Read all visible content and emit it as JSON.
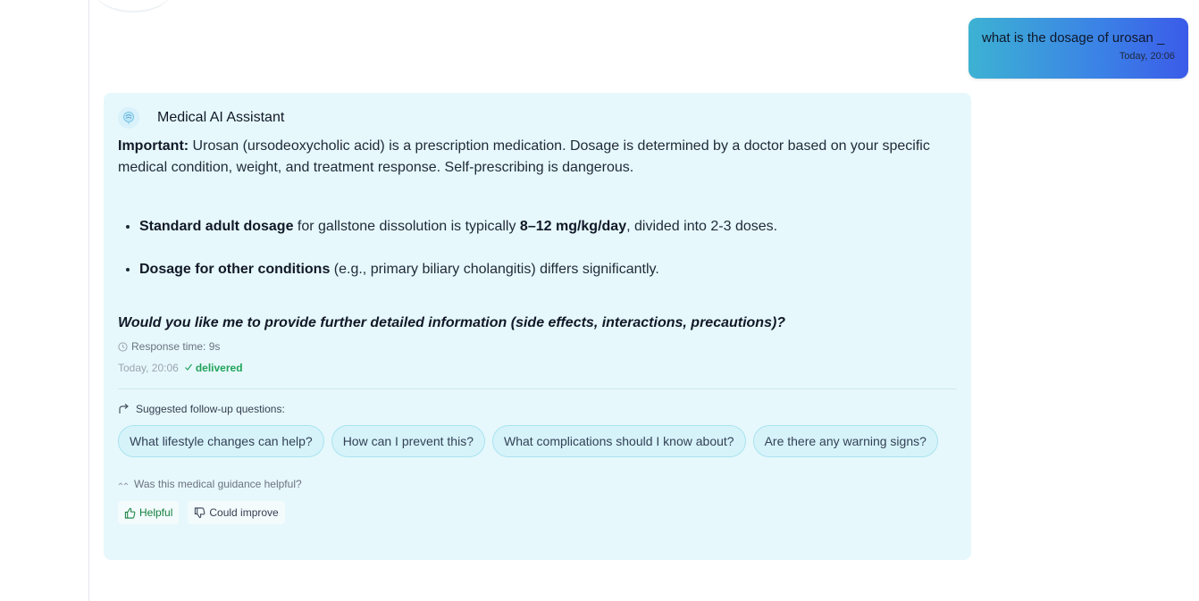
{
  "user_message": {
    "text": "what is the dosage of urosan _",
    "timestamp": "Today, 20:06"
  },
  "assistant": {
    "name": "Medical AI Assistant",
    "avatar_icon": "brain-icon",
    "intro_bold": "Important:",
    "intro_text": " Urosan (ursodeoxycholic acid) is a prescription medication. Dosage is determined by a doctor based on your specific medical condition, weight, and treatment response. Self-prescribing is dangerous.",
    "points": [
      {
        "bold": "Standard adult dosage",
        "text1": " for gallstone dissolution is typically ",
        "bold2": "8–12 mg/kg/day",
        "text2": ", divided into 2-3 doses."
      },
      {
        "bold": "Dosage for other conditions",
        "text1": " (e.g., primary biliary cholangitis) differs significantly.",
        "bold2": "",
        "text2": ""
      }
    ],
    "question": "Would you like me to provide further detailed information (side effects, interactions, precautions)?",
    "response_time": "Response time: 9s",
    "timestamp": "Today, 20:06",
    "status": "delivered"
  },
  "suggestions": {
    "title": "Suggested follow-up questions:",
    "items": [
      "What lifestyle changes can help?",
      "How can I prevent this?",
      "What complications should I know about?",
      "Are there any warning signs?"
    ]
  },
  "feedback": {
    "question": "Was this medical guidance helpful?",
    "helpful_label": "Helpful",
    "improve_label": "Could improve"
  },
  "colors": {
    "card_bg": "#e6f8fc",
    "user_bubble_start": "#3db2d3",
    "user_bubble_end": "#3b5be9",
    "delivered": "#22a35a",
    "helpful": "#15803d"
  }
}
